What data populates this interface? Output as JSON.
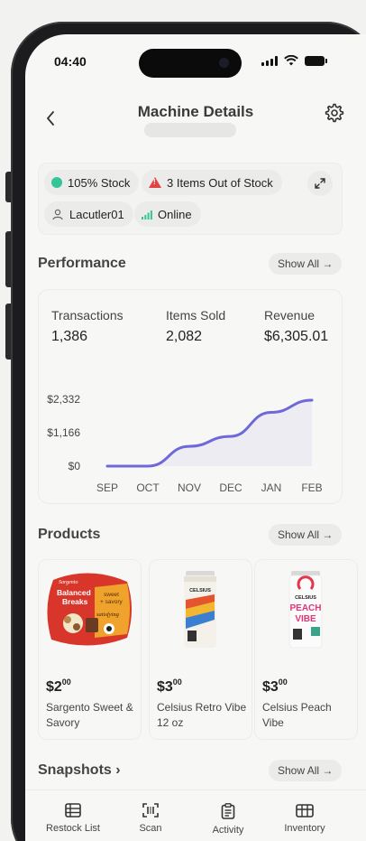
{
  "status_bar": {
    "time": "04:40"
  },
  "header": {
    "title": "Machine Details"
  },
  "status_chips": {
    "stock": "105% Stock",
    "out_of_stock": "3 Items Out of Stock",
    "user": "Lacutler01",
    "connection": "Online"
  },
  "performance": {
    "title": "Performance",
    "show_all": "Show All →",
    "metrics": [
      {
        "label": "Transactions",
        "value": "1,386"
      },
      {
        "label": "Items Sold",
        "value": "2,082"
      },
      {
        "label": "Revenue",
        "value": "$6,305.01"
      }
    ]
  },
  "chart_data": {
    "type": "line",
    "categories": [
      "SEP",
      "OCT",
      "NOV",
      "DEC",
      "JAN",
      "FEB"
    ],
    "series": [
      {
        "values": [
          0,
          0,
          700,
          1050,
          1900,
          2332
        ]
      }
    ],
    "yticks": [
      "$2,332",
      "$1,166",
      "$0"
    ],
    "ylim": [
      0,
      2332
    ],
    "line_color": "#6e68d8",
    "grid": false
  },
  "products": {
    "title": "Products",
    "show_all": "Show All →",
    "items": [
      {
        "price_main": "$2",
        "price_cents": "00",
        "name": "Sargento Sweet & Savory",
        "pkg_brand": "Sargento",
        "pkg_line1": "Balanced",
        "pkg_line2": "Breaks",
        "pkg_tag1": "sweet",
        "pkg_tag2": "+ savory",
        "pkg_tag3": "satisfying"
      },
      {
        "price_main": "$3",
        "price_cents": "00",
        "name": "Celsius Retro Vibe 12 oz",
        "can_brand": "CELSIUS"
      },
      {
        "price_main": "$3",
        "price_cents": "00",
        "name": "Celsius Peach Vibe",
        "can_brand": "CELSIUS",
        "can_flavor1": "PEACH",
        "can_flavor2": "VIBE"
      }
    ]
  },
  "snapshots": {
    "title": "Snapshots ›",
    "show_all": "Show All →"
  },
  "tabbar": {
    "items": [
      {
        "label": "Restock List",
        "icon": "list-icon"
      },
      {
        "label": "Scan",
        "icon": "scan-icon"
      },
      {
        "label": "Activity",
        "icon": "clipboard-icon"
      },
      {
        "label": "Inventory",
        "icon": "inventory-icon"
      }
    ]
  },
  "colors": {
    "accent": "#6e68d8",
    "online": "#33c497",
    "warning": "#e04343"
  }
}
